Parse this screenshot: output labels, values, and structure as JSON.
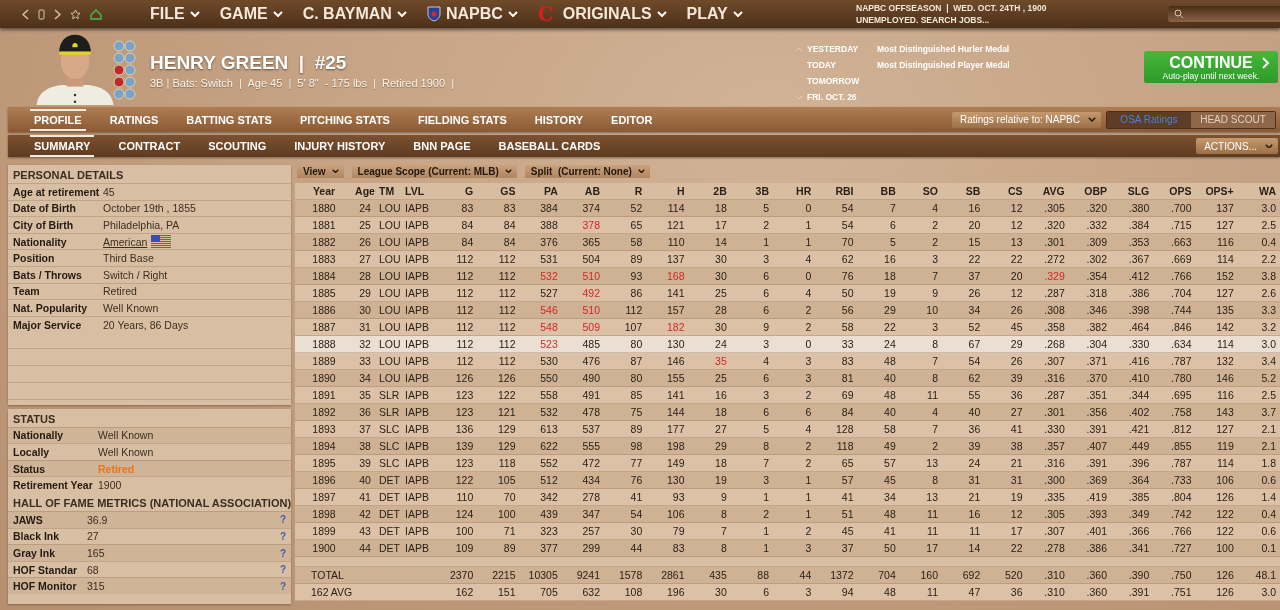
{
  "nav": {
    "menus": [
      {
        "label": "FILE",
        "kind": "plain"
      },
      {
        "label": "GAME",
        "kind": "plain"
      },
      {
        "label": "C. BAYMAN",
        "kind": "plain"
      },
      {
        "label": "NAPBC",
        "kind": "shield"
      },
      {
        "label": "ORIGINALS",
        "kind": "logo",
        "logo": "C"
      },
      {
        "label": "PLAY",
        "kind": "plain"
      }
    ]
  },
  "game_status": {
    "season": "NAPBC OFFSEASON  |  WED. OCT. 24TH , 1900",
    "job": "UNEMPLOYED. SEARCH JOBS..."
  },
  "player": {
    "name": "HENRY GREEN  |  #25",
    "info": "3B | Bats: Switch  |  Age 45  |  5' 8\"  - 175 lbs  |  Retired 1900  |"
  },
  "schedule": [
    {
      "day": "YESTERDAY",
      "event": "Most Distinguished Hurler Medal"
    },
    {
      "day": "TODAY",
      "event": "Most Distinguished Player Medal"
    },
    {
      "day": "TOMORROW"
    },
    {
      "day": "FRI. OCT. 26"
    }
  ],
  "continue_button": {
    "label": "CONTINUE",
    "sublabel": "Auto-play until next week."
  },
  "tabs": [
    {
      "label": "PROFILE",
      "selected": true
    },
    {
      "label": "RATINGS",
      "selected": false
    },
    {
      "label": "BATTING STATS",
      "selected": false
    },
    {
      "label": "PITCHING STATS",
      "selected": false
    },
    {
      "label": "FIELDING STATS",
      "selected": false
    },
    {
      "label": "HISTORY",
      "selected": false
    },
    {
      "label": "EDITOR",
      "selected": false
    }
  ],
  "ratings_dropdown": "Ratings relative to: NAPBC",
  "ratings_source": [
    {
      "label": "OSA Ratings",
      "selected": true
    },
    {
      "label": "HEAD SCOUT",
      "selected": false
    }
  ],
  "subtabs": [
    {
      "label": "SUMMARY",
      "selected": true
    },
    {
      "label": "CONTRACT",
      "selected": false
    },
    {
      "label": "SCOUTING",
      "selected": false
    },
    {
      "label": "INJURY HISTORY",
      "selected": false
    },
    {
      "label": "BNN PAGE",
      "selected": false
    },
    {
      "label": "BASEBALL CARDS",
      "selected": false
    }
  ],
  "actions_dropdown": "ACTIONS...",
  "personal_details": {
    "title": "PERSONAL DETAILS",
    "rows": [
      {
        "label": "Age at retirement",
        "value": "45",
        "kind": "text"
      },
      {
        "label": "Date of Birth",
        "value": "October 19th , 1855",
        "kind": "text"
      },
      {
        "label": "City of Birth",
        "value": "Philadelphia, PA",
        "kind": "text"
      },
      {
        "label": "Nationality",
        "value": "American",
        "kind": "link"
      },
      {
        "label": "Position",
        "value": "Third Base",
        "kind": "text"
      },
      {
        "label": "Bats / Throws",
        "value": "Switch / Right",
        "kind": "text"
      },
      {
        "label": "Team",
        "value": "Retired",
        "kind": "text"
      },
      {
        "label": "Nat. Popularity",
        "value": "Well Known",
        "kind": "text"
      },
      {
        "label": "Major Service",
        "value": "20 Years, 86 Days",
        "kind": "text"
      }
    ]
  },
  "status": {
    "title": "STATUS",
    "rows": [
      {
        "label": "Nationally",
        "value": "Well Known",
        "alert": false
      },
      {
        "label": "Locally",
        "value": "Well Known",
        "alert": false
      },
      {
        "label": "Status",
        "value": "Retired",
        "alert": true
      },
      {
        "label": "Retirement Year",
        "value": "1900",
        "alert": false
      }
    ]
  },
  "hall_of_fame": {
    "title": "HALL OF FAME METRICS (NATIONAL ASSOCIATION)",
    "rows": [
      {
        "label": "JAWS",
        "value": "36.9"
      },
      {
        "label": "Black Ink",
        "value": "27"
      },
      {
        "label": "Gray Ink",
        "value": "165"
      },
      {
        "label": "HOF Standar",
        "value": "68"
      },
      {
        "label": "HOF Monitor",
        "value": "315"
      }
    ],
    "help": "?"
  },
  "filters": [
    "View",
    "League Scope (Current: MLB)",
    "Split  (Current: None)"
  ],
  "table": {
    "columns": [
      "Year",
      "Age",
      "TM",
      "LVL",
      "G",
      "GS",
      "PA",
      "AB",
      "R",
      "H",
      "2B",
      "3B",
      "HR",
      "RBI",
      "BB",
      "SO",
      "SB",
      "CS",
      "AVG",
      "OBP",
      "SLG",
      "OPS",
      "OPS+",
      "WA"
    ],
    "rows": [
      {
        "selected": false,
        "cells": [
          "1880",
          "24",
          "LOU",
          "IAPB",
          "83",
          "83",
          "384",
          "374",
          "52",
          "114",
          "18",
          "5",
          "0",
          "54",
          "7",
          "4",
          "16",
          "12",
          ".305",
          ".320",
          ".380",
          ".700",
          "137",
          "3.0"
        ]
      },
      {
        "selected": false,
        "cells": [
          "1881",
          "25",
          "LOU",
          "IAPB",
          "84",
          "84",
          "388",
          {
            "text": "378",
            "leader": true
          },
          "65",
          "121",
          "17",
          "2",
          "1",
          "54",
          "6",
          "2",
          "20",
          "12",
          ".320",
          ".332",
          ".384",
          ".715",
          "127",
          "2.5"
        ]
      },
      {
        "selected": false,
        "cells": [
          "1882",
          "26",
          "LOU",
          "IAPB",
          "84",
          "84",
          "376",
          "365",
          "58",
          "110",
          "14",
          "1",
          "1",
          "70",
          "5",
          "2",
          "15",
          "13",
          ".301",
          ".309",
          ".353",
          ".663",
          "116",
          "0.4"
        ]
      },
      {
        "selected": false,
        "cells": [
          "1883",
          "27",
          "LOU",
          "IAPB",
          "112",
          "112",
          "531",
          "504",
          "89",
          "137",
          "30",
          "3",
          "4",
          "62",
          "16",
          "3",
          "22",
          "22",
          ".272",
          ".302",
          ".367",
          ".669",
          "114",
          "2.2"
        ]
      },
      {
        "selected": false,
        "cells": [
          "1884",
          "28",
          "LOU",
          "IAPB",
          "112",
          "112",
          {
            "text": "532",
            "leader": true
          },
          {
            "text": "510",
            "leader": true
          },
          "93",
          {
            "text": "168",
            "leader": true
          },
          "30",
          "6",
          "0",
          "76",
          "18",
          "7",
          "37",
          "20",
          {
            "text": ".329",
            "leader": true
          },
          ".354",
          ".412",
          ".766",
          "152",
          "3.8"
        ]
      },
      {
        "selected": false,
        "cells": [
          "1885",
          "29",
          "LOU",
          "IAPB",
          "112",
          "112",
          "527",
          {
            "text": "492",
            "leader": true
          },
          "86",
          "141",
          "25",
          "6",
          "4",
          "50",
          "19",
          "9",
          "26",
          "12",
          ".287",
          ".318",
          ".386",
          ".704",
          "127",
          "2.6"
        ]
      },
      {
        "selected": false,
        "cells": [
          "1886",
          "30",
          "LOU",
          "IAPB",
          "112",
          "112",
          {
            "text": "546",
            "leader": true
          },
          {
            "text": "510",
            "leader": true
          },
          "112",
          "157",
          "28",
          "6",
          "2",
          "56",
          "29",
          "10",
          "34",
          "26",
          ".308",
          ".346",
          ".398",
          ".744",
          "135",
          "3.3"
        ]
      },
      {
        "selected": false,
        "cells": [
          "1887",
          "31",
          "LOU",
          "IAPB",
          "112",
          "112",
          {
            "text": "548",
            "leader": true
          },
          {
            "text": "509",
            "leader": true
          },
          "107",
          {
            "text": "182",
            "leader": true
          },
          "30",
          "9",
          "2",
          "58",
          "22",
          "3",
          "52",
          "45",
          ".358",
          ".382",
          ".464",
          ".846",
          "142",
          "3.2"
        ]
      },
      {
        "selected": true,
        "cells": [
          "1888",
          "32",
          "LOU",
          "IAPB",
          "112",
          "112",
          {
            "text": "523",
            "leader": true
          },
          "485",
          "80",
          "130",
          "24",
          "3",
          "0",
          "33",
          "24",
          "8",
          "67",
          "29",
          ".268",
          ".304",
          ".330",
          ".634",
          "114",
          "3.0"
        ]
      },
      {
        "selected": false,
        "cells": [
          "1889",
          "33",
          "LOU",
          "IAPB",
          "112",
          "112",
          "530",
          "476",
          "87",
          "146",
          {
            "text": "35",
            "leader": true
          },
          "4",
          "3",
          "83",
          "48",
          "7",
          "54",
          "26",
          ".307",
          ".371",
          ".416",
          ".787",
          "132",
          "3.4"
        ]
      },
      {
        "selected": false,
        "cells": [
          "1890",
          "34",
          "LOU",
          "IAPB",
          "126",
          "126",
          "550",
          "490",
          "80",
          "155",
          "25",
          "6",
          "3",
          "81",
          "40",
          "8",
          "62",
          "39",
          ".316",
          ".370",
          ".410",
          ".780",
          "146",
          "5.2"
        ]
      },
      {
        "selected": false,
        "cells": [
          "1891",
          "35",
          "SLR",
          "IAPB",
          "123",
          "122",
          "558",
          "491",
          "85",
          "141",
          "16",
          "3",
          "2",
          "69",
          "48",
          "11",
          "55",
          "36",
          ".287",
          ".351",
          ".344",
          ".695",
          "116",
          "2.5"
        ]
      },
      {
        "selected": false,
        "cells": [
          "1892",
          "36",
          "SLR",
          "IAPB",
          "123",
          "121",
          "532",
          "478",
          "75",
          "144",
          "18",
          "6",
          "6",
          "84",
          "40",
          "4",
          "40",
          "27",
          ".301",
          ".356",
          ".402",
          ".758",
          "143",
          "3.7"
        ]
      },
      {
        "selected": false,
        "cells": [
          "1893",
          "37",
          "SLC",
          "IAPB",
          "136",
          "129",
          "613",
          "537",
          "89",
          "177",
          "27",
          "5",
          "4",
          "128",
          "58",
          "7",
          "36",
          "41",
          ".330",
          ".391",
          ".421",
          ".812",
          "127",
          "2.1"
        ]
      },
      {
        "selected": false,
        "cells": [
          "1894",
          "38",
          "SLC",
          "IAPB",
          "139",
          "129",
          "622",
          "555",
          "98",
          "198",
          "29",
          "8",
          "2",
          "118",
          "49",
          "2",
          "39",
          "38",
          ".357",
          ".407",
          ".449",
          ".855",
          "119",
          "2.1"
        ]
      },
      {
        "selected": false,
        "cells": [
          "1895",
          "39",
          "SLC",
          "IAPB",
          "123",
          "118",
          "552",
          "472",
          "77",
          "149",
          "18",
          "7",
          "2",
          "65",
          "57",
          "13",
          "24",
          "21",
          ".316",
          ".391",
          ".396",
          ".787",
          "114",
          "1.8"
        ]
      },
      {
        "selected": false,
        "cells": [
          "1896",
          "40",
          "DET",
          "IAPB",
          "122",
          "105",
          "512",
          "434",
          "76",
          "130",
          "19",
          "3",
          "1",
          "57",
          "45",
          "8",
          "31",
          "31",
          ".300",
          ".369",
          ".364",
          ".733",
          "106",
          "0.6"
        ]
      },
      {
        "selected": false,
        "cells": [
          "1897",
          "41",
          "DET",
          "IAPB",
          "110",
          "70",
          "342",
          "278",
          "41",
          "93",
          "9",
          "1",
          "1",
          "41",
          "34",
          "13",
          "21",
          "19",
          ".335",
          ".419",
          ".385",
          ".804",
          "126",
          "1.4"
        ]
      },
      {
        "selected": false,
        "cells": [
          "1898",
          "42",
          "DET",
          "IAPB",
          "124",
          "100",
          "439",
          "347",
          "54",
          "106",
          "8",
          "2",
          "1",
          "51",
          "48",
          "11",
          "16",
          "12",
          ".305",
          ".393",
          ".349",
          ".742",
          "122",
          "0.4"
        ]
      },
      {
        "selected": false,
        "cells": [
          "1899",
          "43",
          "DET",
          "IAPB",
          "100",
          "71",
          "323",
          "257",
          "30",
          "79",
          "7",
          "1",
          "2",
          "45",
          "41",
          "11",
          "11",
          "17",
          ".307",
          ".401",
          ".366",
          ".766",
          "122",
          "0.6"
        ]
      },
      {
        "selected": false,
        "cells": [
          "1900",
          "44",
          "DET",
          "IAPB",
          "109",
          "89",
          "377",
          "299",
          "44",
          "83",
          "8",
          "1",
          "3",
          "37",
          "50",
          "17",
          "14",
          "22",
          ".278",
          ".386",
          ".341",
          ".727",
          "100",
          "0.1"
        ]
      }
    ],
    "totals": [
      {
        "label": "TOTAL",
        "cells": [
          "2370",
          "2215",
          "10305",
          "9241",
          "1578",
          "2861",
          "435",
          "88",
          "44",
          "1372",
          "704",
          "160",
          "692",
          "520",
          ".310",
          ".360",
          ".390",
          ".750",
          "126",
          "48.1"
        ]
      },
      {
        "label": "162 AVG",
        "cells": [
          "162",
          "151",
          "705",
          "632",
          "108",
          "196",
          "30",
          "6",
          "3",
          "94",
          "48",
          "11",
          "47",
          "36",
          ".310",
          ".360",
          ".391",
          ".751",
          "126",
          "3.0"
        ]
      }
    ]
  }
}
